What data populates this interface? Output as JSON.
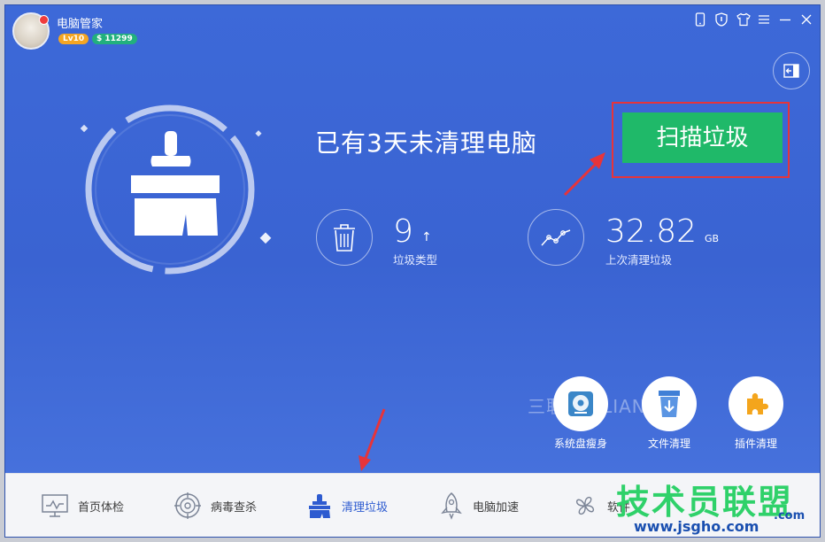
{
  "app": {
    "title": "电脑管家",
    "level_badge": "Lv10",
    "coin_badge": "$ 11299"
  },
  "titlebar_icons": [
    "phone-icon",
    "shield-icon",
    "skin-icon",
    "menu-icon",
    "minimize-icon",
    "close-icon"
  ],
  "main": {
    "status_text": "已有3天未清理电脑",
    "scan_button": "扫描垃圾",
    "stats": [
      {
        "value": "9",
        "arrow": "↑",
        "unit": "",
        "label": "垃圾类型"
      },
      {
        "value": "32.82",
        "arrow": "",
        "unit": "GB",
        "label": "上次清理垃圾"
      }
    ],
    "watermark": "三联网 3LIAN.COM"
  },
  "tools": [
    {
      "label": "系统盘瘦身",
      "icon": "disk-slim-icon"
    },
    {
      "label": "文件清理",
      "icon": "file-clean-icon"
    },
    {
      "label": "插件清理",
      "icon": "plugin-clean-icon"
    }
  ],
  "nav": [
    {
      "label": "首页体检",
      "icon": "monitor-icon",
      "active": false
    },
    {
      "label": "病毒查杀",
      "icon": "virus-scan-icon",
      "active": false
    },
    {
      "label": "清理垃圾",
      "icon": "broom-icon",
      "active": true
    },
    {
      "label": "电脑加速",
      "icon": "rocket-icon",
      "active": false
    },
    {
      "label": "软件",
      "icon": "software-icon",
      "active": false
    }
  ],
  "brand": {
    "name": "技术员联盟",
    "url": "www.jsgho.com",
    "com": ".com"
  },
  "colors": {
    "primary_blue": "#3a66d4",
    "scan_green": "#1fb969",
    "highlight_red": "#e7343a",
    "brand_green": "#2fd16a"
  }
}
